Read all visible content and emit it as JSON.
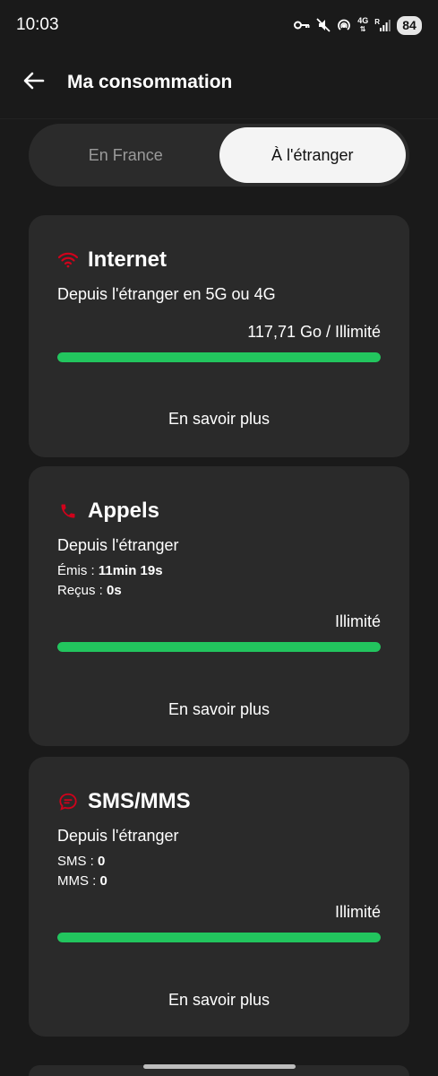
{
  "status": {
    "time": "10:03",
    "network_top": "4G",
    "network_roaming": "R",
    "battery": "84"
  },
  "header": {
    "title": "Ma consommation"
  },
  "tabs": {
    "france": "En France",
    "abroad": "À l'étranger",
    "selected": "abroad"
  },
  "cards": {
    "internet": {
      "icon": "wifi-icon",
      "title": "Internet",
      "subtitle": "Depuis l'étranger en 5G ou 4G",
      "amount": "117,71 Go / Illimité",
      "progress": 1.0,
      "link": "En savoir plus"
    },
    "calls": {
      "icon": "phone-icon",
      "title": "Appels",
      "subtitle": "Depuis l'étranger",
      "sent_label": "Émis :",
      "sent_value": "11min 19s",
      "received_label": "Reçus :",
      "received_value": "0s",
      "amount": "Illimité",
      "progress": 1.0,
      "link": "En savoir plus"
    },
    "sms": {
      "icon": "message-icon",
      "title": "SMS/MMS",
      "subtitle": "Depuis l'étranger",
      "sms_label": "SMS :",
      "sms_value": "0",
      "mms_label": "MMS :",
      "mms_value": "0",
      "amount": "Illimité",
      "progress": 1.0,
      "link": "En savoir plus"
    }
  },
  "colors": {
    "accent_red": "#d0021b",
    "progress_green": "#22c55e",
    "card_bg": "#2a2a2a",
    "page_bg": "#1a1a1a"
  }
}
